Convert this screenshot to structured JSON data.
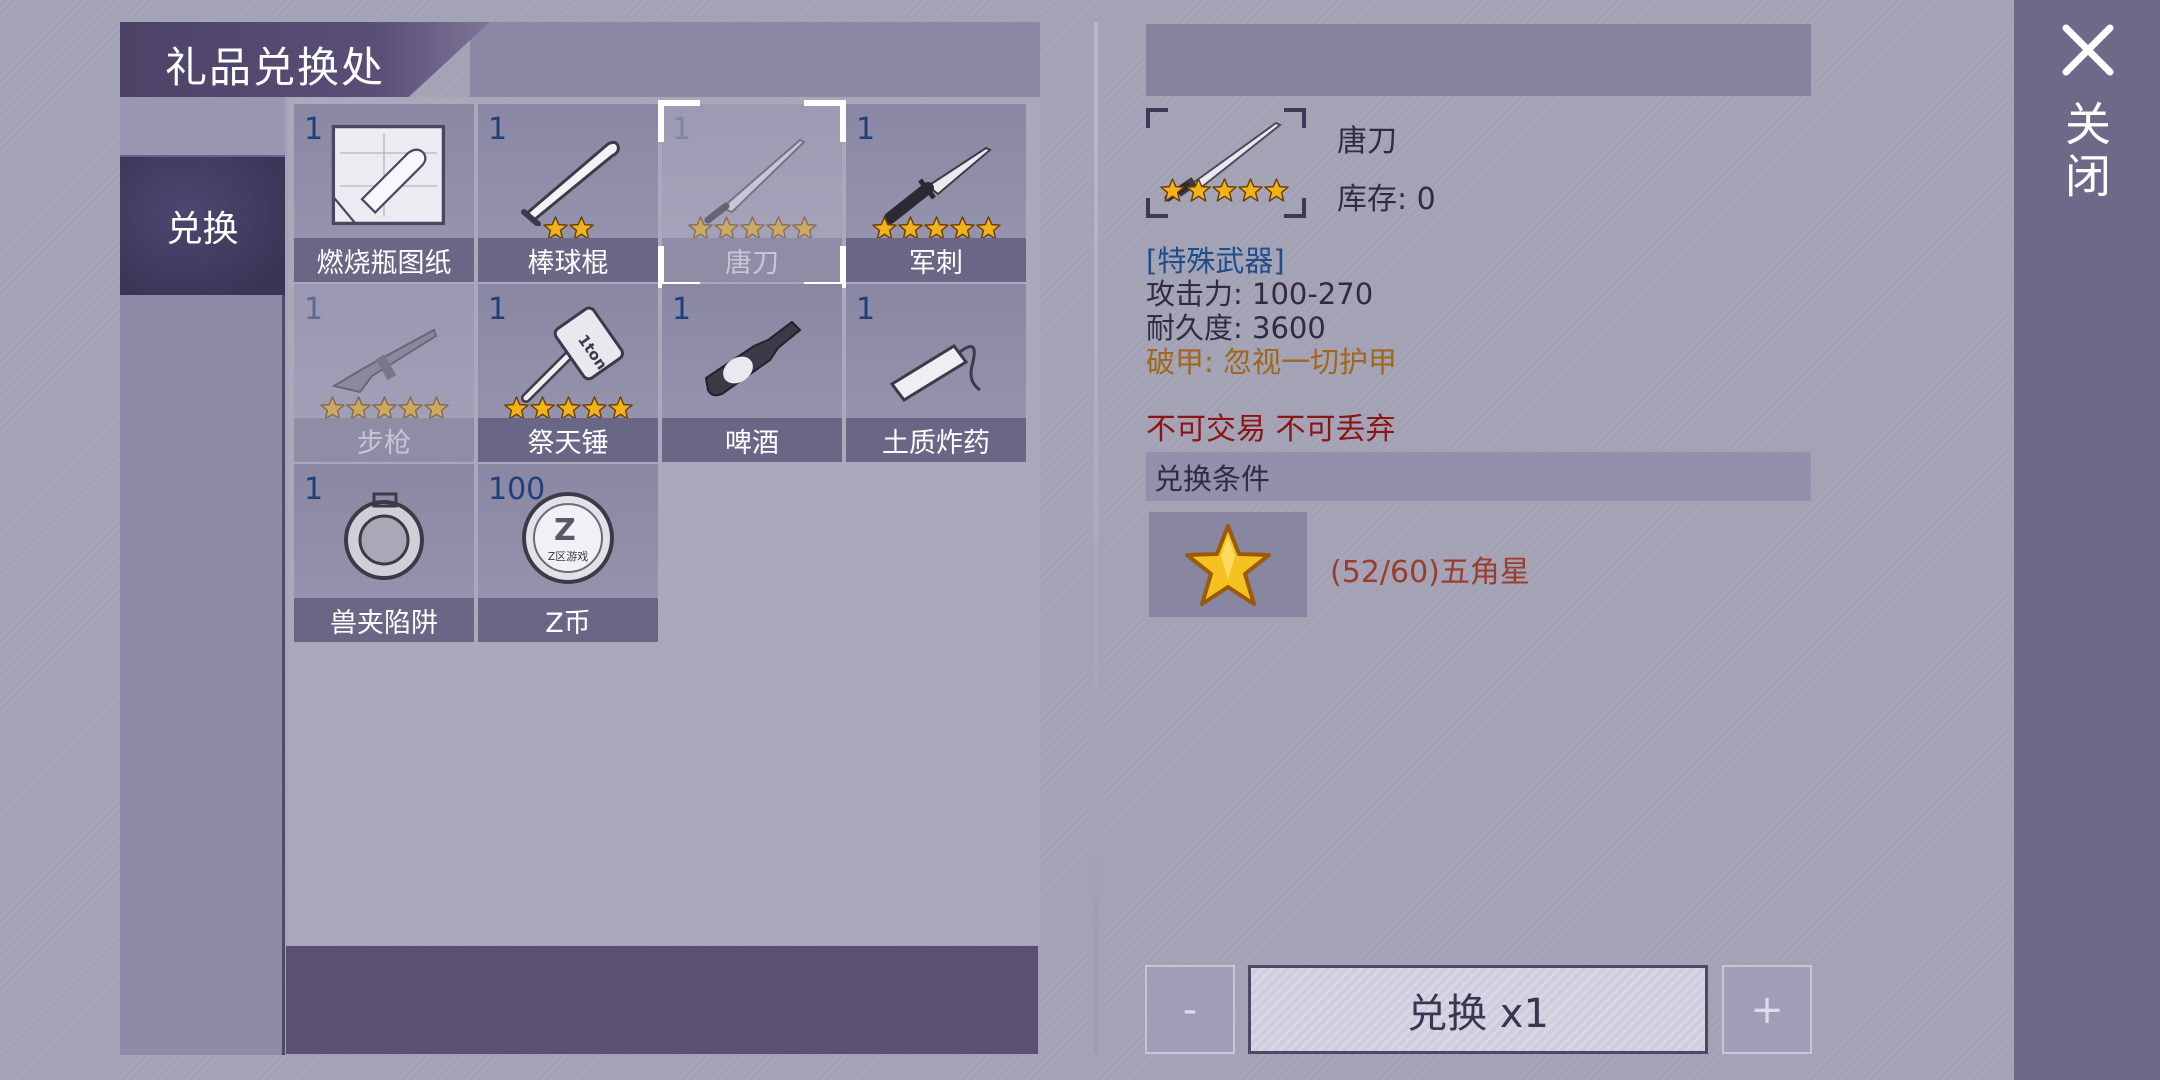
{
  "title": "礼品兑换处",
  "sidebar": {
    "active_tab": "兑换"
  },
  "items": [
    {
      "name": "燃烧瓶图纸",
      "count": "1",
      "stars": 0,
      "icon": "molotov-blueprint-icon",
      "state": "normal"
    },
    {
      "name": "棒球棍",
      "count": "1",
      "stars": 2,
      "icon": "baseball-bat-icon",
      "state": "normal"
    },
    {
      "name": "唐刀",
      "count": "1",
      "stars": 5,
      "icon": "tang-dao-icon",
      "state": "selected"
    },
    {
      "name": "军刺",
      "count": "1",
      "stars": 5,
      "icon": "bayonet-icon",
      "state": "normal"
    },
    {
      "name": "步枪",
      "count": "1",
      "stars": 5,
      "icon": "rifle-icon",
      "state": "dim"
    },
    {
      "name": "祭天锤",
      "count": "1",
      "stars": 5,
      "icon": "hammer-icon",
      "state": "normal"
    },
    {
      "name": "啤酒",
      "count": "1",
      "stars": 0,
      "icon": "beer-bottle-icon",
      "state": "normal"
    },
    {
      "name": "土质炸药",
      "count": "1",
      "stars": 0,
      "icon": "dynamite-icon",
      "state": "normal"
    },
    {
      "name": "兽夹陷阱",
      "count": "1",
      "stars": 0,
      "icon": "bear-trap-icon",
      "state": "normal"
    },
    {
      "name": "Z币",
      "count": "100",
      "stars": 0,
      "icon": "z-coin-icon",
      "state": "normal"
    }
  ],
  "item_hammer_label": "1ton",
  "coin_label": "Z区游戏",
  "detail": {
    "name": "唐刀",
    "stock": "库存: 0",
    "stars": 5,
    "category": "[特殊武器]",
    "attack": "攻击力: 100-270",
    "durability": "耐久度: 3600",
    "armor": "破甲: 忽视一切护甲",
    "restriction": "不可交易 不可丢弃",
    "condition_header": "兑换条件",
    "condition_text": "(52/60)五角星"
  },
  "buttons": {
    "minus": "-",
    "exchange": "兑换 x1",
    "plus": "+"
  },
  "close_label": "关闭",
  "colors": {
    "accent": "#5b5073",
    "star_gold": "#f2b21a",
    "category_blue": "#1f4d8c",
    "restrict_red": "#8c1414"
  }
}
